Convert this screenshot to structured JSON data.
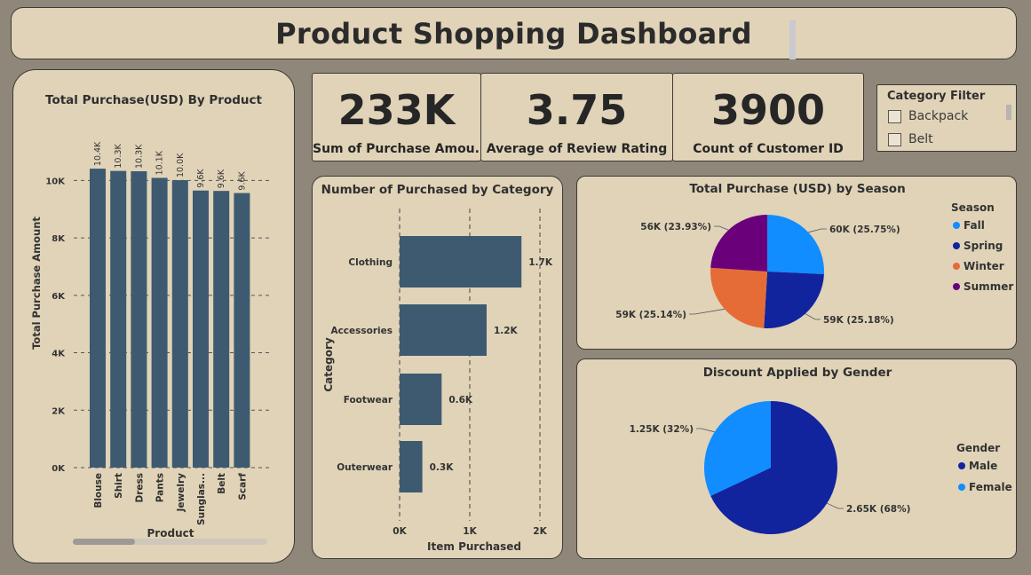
{
  "header": {
    "title": "Product Shopping Dashboard"
  },
  "kpis": [
    {
      "value": "233K",
      "label": "Sum of Purchase Amou..."
    },
    {
      "value": "3.75",
      "label": "Average of Review Rating"
    },
    {
      "value": "3900",
      "label": "Count of Customer ID"
    }
  ],
  "filter": {
    "title": "Category Filter",
    "items": [
      "Backpack",
      "Belt"
    ]
  },
  "chart_data": [
    {
      "type": "bar",
      "title": "Total Purchase(USD) By Product",
      "xlabel": "Product",
      "ylabel": "Total Purchase Amount",
      "categories": [
        "Blouse",
        "Shirt",
        "Dress",
        "Pants",
        "Jewelry",
        "Sunglas...",
        "Belt",
        "Scarf"
      ],
      "values": [
        10410,
        10332,
        10320,
        10090,
        10010,
        9649,
        9635,
        9561
      ],
      "data_labels": [
        "10.4K",
        "10.3K",
        "10.3K",
        "10.1K",
        "10.0K",
        "9.6K",
        "9.6K",
        "9.6K"
      ],
      "yticks": [
        "0K",
        "2K",
        "4K",
        "6K",
        "8K",
        "10K"
      ],
      "ylim": [
        0,
        11000
      ],
      "color": "#3d5a70"
    },
    {
      "type": "bar",
      "orientation": "horizontal",
      "title": "Number of Purchased by Category",
      "xlabel": "Item Purchased",
      "ylabel": "Category",
      "categories": [
        "Clothing",
        "Accessories",
        "Footwear",
        "Outerwear"
      ],
      "values": [
        1737,
        1240,
        599,
        324
      ],
      "data_labels": [
        "1.7K",
        "1.2K",
        "0.6K",
        "0.3K"
      ],
      "xticks": [
        "0K",
        "1K",
        "2K"
      ],
      "xlim": [
        0,
        2000
      ],
      "color": "#3d5a70"
    },
    {
      "type": "pie",
      "title": "Total Purchase (USD) by Season",
      "legend_title": "Season",
      "legend_position": "right",
      "slices": [
        {
          "name": "Fall",
          "value": 25.75,
          "label": "60K (25.75%)",
          "color": "#118dff"
        },
        {
          "name": "Spring",
          "value": 25.18,
          "label": "59K (25.18%)",
          "color": "#12239e"
        },
        {
          "name": "Winter",
          "value": 25.14,
          "label": "59K (25.14%)",
          "color": "#e66c37"
        },
        {
          "name": "Summer",
          "value": 23.93,
          "label": "56K (23.93%)",
          "color": "#6b007b"
        }
      ]
    },
    {
      "type": "pie",
      "title": "Discount Applied by Gender",
      "legend_title": "Gender",
      "legend_position": "right",
      "slices": [
        {
          "name": "Male",
          "value": 68,
          "label": "2.65K (68%)",
          "color": "#12239e"
        },
        {
          "name": "Female",
          "value": 32,
          "label": "1.25K (32%)",
          "color": "#118dff"
        }
      ]
    }
  ]
}
